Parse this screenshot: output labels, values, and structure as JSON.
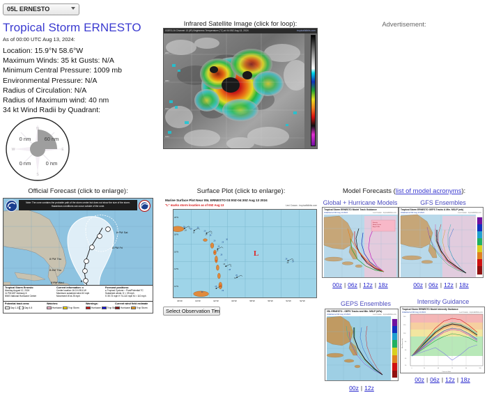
{
  "storm_selector": {
    "value": "05L ERNESTO",
    "icon": "chevron-down-icon"
  },
  "header": {
    "title": "Tropical Storm ERNESTO",
    "as_of": "As of 00:00 UTC Aug 13, 2024:"
  },
  "facts": [
    "Location: 15.9°N 58.6°W",
    "Maximum Winds: 35 kt  Gusts: N/A",
    "Minimum Central Pressure: 1009 mb",
    "Environmental Pressure: N/A",
    "Radius of Circulation: N/A",
    "Radius of Maximum wind: 40 nm",
    "34 kt Wind Radii by Quadrant:"
  ],
  "wind_radii": {
    "ne": "60 nm",
    "se": "0 nm",
    "sw": "0 nm",
    "nw": "0 nm",
    "compass": {
      "n": "N",
      "e": "E",
      "s": "S",
      "w": "W"
    }
  },
  "satellite": {
    "caption": "Infrared Satellite Image (click for loop):",
    "image_header": "GOES-16 Channel 13 (IR) Brightness Temperature (°C) at 04:05Z Aug 13, 2024",
    "image_credit": "tropicaltidbits.com",
    "colorbar_labels": [
      "40",
      "30",
      "20",
      "10",
      "0",
      "-10",
      "-20",
      "-30",
      "-40",
      "-50",
      "-60",
      "-70",
      "-80",
      "-90"
    ]
  },
  "advertisement": {
    "label": "Advertisement:"
  },
  "official_forecast": {
    "caption": "Official Forecast (click to enlarge):",
    "cone_note": "Note: The cone contains the probable path of the storm center but does not show the size of the storm. Hazardous conditions can occur outside of the cone.",
    "left_seal": "noaa-seal-icon",
    "right_seal": "nhc-seal-icon",
    "track_labels": [
      "11 PM Mon",
      "8 PM Tue",
      "8 AM Wed",
      "8 PM Wed",
      "8 AM Thu",
      "8 PM Thu",
      "8 PM Fri",
      "8 PM Sat"
    ],
    "legend": {
      "storm_name": "Tropical Storm Ernesto",
      "advisory_date": "Monday August 12, 2024",
      "advisory_time": "11 PM AST Advisory 6",
      "agency": "NWS National Hurricane Center",
      "current_info_title": "Current information:",
      "current_info_x": "x",
      "center_location": "Center location 16.0 N 59.6 W",
      "max_sustained_wind": "Maximum sustained wind 40 mph",
      "movement": "Movement W at 25 mph",
      "forecast_positions_title": "Forecast positions:",
      "tropical_cyclone": "Tropical Cyclone",
      "post_potential_tc": "Post/Potential TC",
      "sustained_winds_label": "Sustained winds:",
      "d_label": "D < 39 mph",
      "s_label": "S 39-73 mph",
      "h_label": "H 74-110 mph",
      "m_label": "M > 110 mph",
      "potential_track_title": "Potential track area:",
      "day13": "Day 1-3",
      "day45": "Day 4-5",
      "watches_title": "Watches:",
      "warnings_title": "Warnings:",
      "wind_field_title": "Current wind field estimate",
      "hurricane": "Hurricane",
      "trop_storm": "Trop Storm"
    }
  },
  "surface_plot": {
    "caption": "Surface Plot (click to enlarge):",
    "title": "Marine Surface Plot Near 05L ERNESTO 03:00Z-04:30Z Aug 13 2024",
    "subtitle": "\"L\" marks storm location as of 00Z Aug 13",
    "credit": "Levi Cowan - tropicaltidbits.com",
    "low_marker": "L",
    "y_ticks": [
      "20°N",
      "18°N",
      "16°N",
      "14°N",
      "12°N"
    ],
    "x_ticks": [
      "66°W",
      "64°W",
      "62°W",
      "60°W",
      "58°W",
      "56°W",
      "54°W",
      "52°W"
    ],
    "observation_select": {
      "value": "Select Observation Time...",
      "icon": "chevron-down-icon"
    }
  },
  "model_forecasts": {
    "caption_prefix": "Model Forecasts (",
    "caption_link": "list of model acronyms",
    "caption_suffix": "):",
    "panels": [
      {
        "heading": "Global + Hurricane Models",
        "chart_title": "Tropical Storm ERNESTO Model Track Guidance",
        "chart_sub": "Initialized at 00z Aug 13 2024",
        "chart_credit": "Levi Cowan - tropicaltidbits.com",
        "links": [
          "00z",
          "06z",
          "12z",
          "18z"
        ]
      },
      {
        "heading": "GFS Ensembles",
        "chart_title": "Tropical Storm ERNESTO GEFS Tracks & Min. MSLP (mb)",
        "chart_sub": "Initialized at 00z Aug 13 2024",
        "chart_credit": "Levi Cowan - tropicaltidbits.com",
        "links": [
          "00z",
          "06z",
          "12z",
          "18z"
        ]
      },
      {
        "heading": "GEPS Ensembles",
        "chart_title": "05L ERNESTO - GEPS Tracks and Min. MSLP (hPa)",
        "chart_sub": "Initialized at 00z Aug 13 2024",
        "chart_credit": "Levi Cowan - tropicaltidbits.com",
        "links": [
          "00z",
          "12z"
        ]
      },
      {
        "heading": "Intensity Guidance",
        "chart_title": "Tropical Storm ERNESTO Model Intensity Guidance",
        "chart_sub": "Initialized at 00z Aug 13 2024",
        "chart_credit": "Levi Cowan - tropicaltidbits.com",
        "links": [
          "00z",
          "06z",
          "12z",
          "18z"
        ]
      }
    ],
    "separator": "|"
  },
  "colors": {
    "link": "#2222cc",
    "title": "#3a3ad0",
    "heading": "#4b4bbf",
    "ocean": "#8ec3e0",
    "surface_ocean": "#9ed4e8",
    "low_red": "#e02020"
  }
}
